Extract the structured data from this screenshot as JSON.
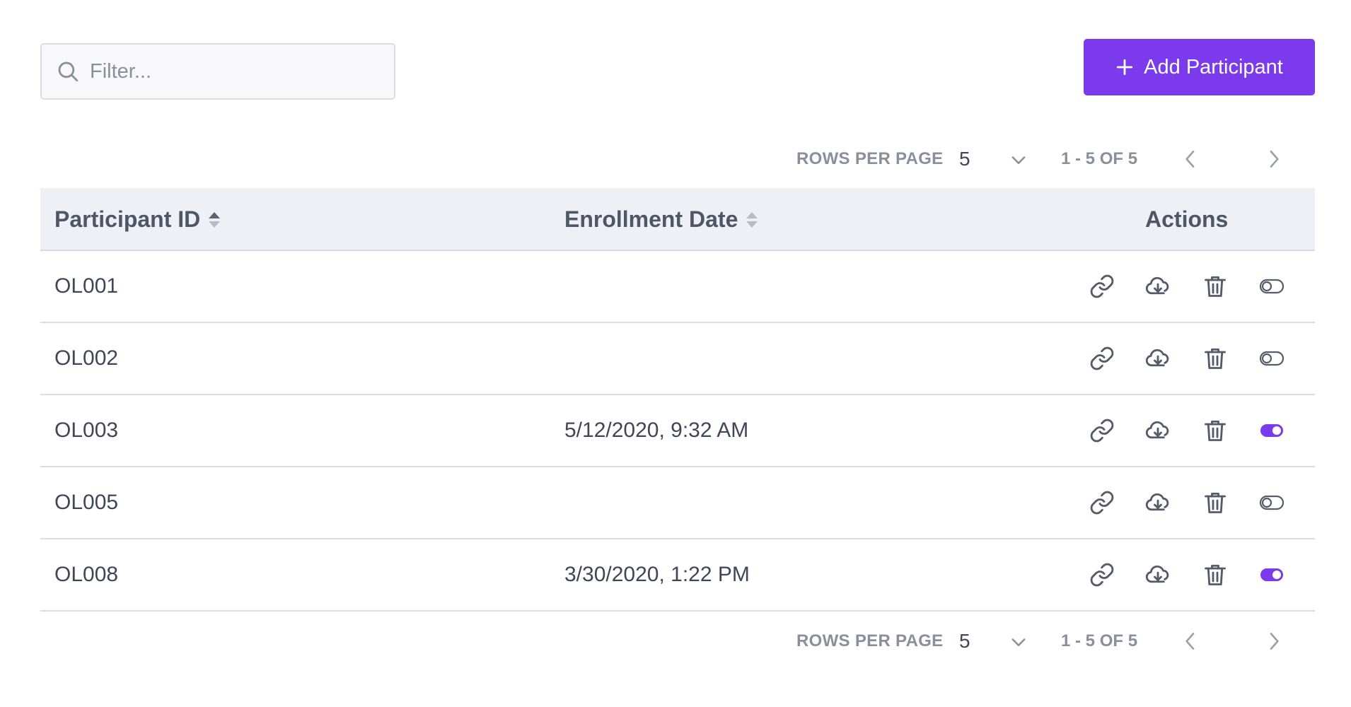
{
  "toolbar": {
    "filter_placeholder": "Filter...",
    "add_button_label": "Add Participant"
  },
  "pagination": {
    "rows_per_page_label": "ROWS PER PAGE",
    "rows_per_page_value": "5",
    "range_text": "1 - 5 OF 5"
  },
  "table": {
    "columns": {
      "participant_id": "Participant ID",
      "enrollment_date": "Enrollment Date",
      "actions": "Actions"
    },
    "rows": [
      {
        "id": "OL001",
        "enrollment_date": "",
        "enabled": false
      },
      {
        "id": "OL002",
        "enrollment_date": "",
        "enabled": false
      },
      {
        "id": "OL003",
        "enrollment_date": "5/12/2020, 9:32 AM",
        "enabled": true
      },
      {
        "id": "OL005",
        "enrollment_date": "",
        "enabled": false
      },
      {
        "id": "OL008",
        "enrollment_date": "3/30/2020, 1:22 PM",
        "enabled": true
      }
    ]
  },
  "icons": {
    "search": "search-icon",
    "plus": "plus-icon",
    "chevron_down": "chevron-down-icon",
    "chevron_left": "chevron-left-icon",
    "chevron_right": "chevron-right-icon",
    "sort": "sort-icon",
    "link": "link-icon",
    "download": "cloud-download-icon",
    "delete": "trash-icon",
    "toggle": "toggle-icon"
  },
  "colors": {
    "accent": "#7c3aed",
    "text": "#3f4655",
    "muted": "#8a8f9b",
    "header_bg": "#eff0f5",
    "icon": "#555b68"
  }
}
